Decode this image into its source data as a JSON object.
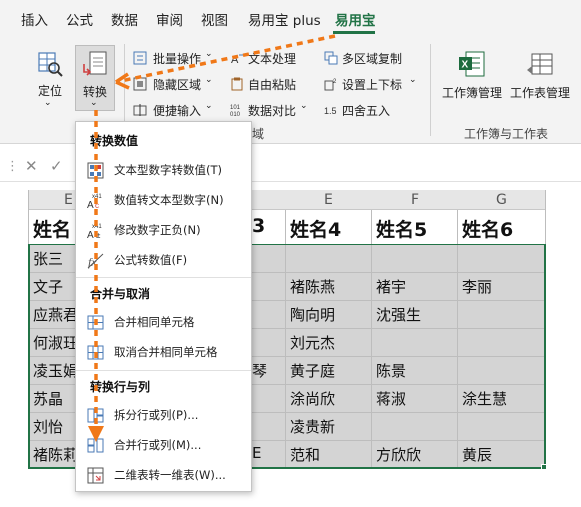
{
  "tabs": [
    {
      "label": "插入"
    },
    {
      "label": "公式"
    },
    {
      "label": "数据"
    },
    {
      "label": "审阅"
    },
    {
      "label": "视图"
    },
    {
      "label": "易用宝 plus"
    },
    {
      "label": "易用宝"
    }
  ],
  "ribbon": {
    "locate": "定位",
    "convert": "转换",
    "batch_ops": "批量操作",
    "text_process": "文本处理",
    "multi_copy": "多区域复制",
    "hide_area": "隐藏区域",
    "free_paste": "自由粘贴",
    "set_sub": "设置上下标",
    "quick_input": "便捷输入",
    "data_compare": "数据对比",
    "round": "四舍五入",
    "area_label": "域",
    "wb_manage": "工作簿管理",
    "ws_manage": "工作表管理",
    "group_label": "工作簿与工作表"
  },
  "menu": {
    "sec_convert": "转换数值",
    "sec_merge": "合并与取消",
    "sec_rowcol": "转换行与列",
    "items": [
      {
        "label": "文本型数字转数值(T)"
      },
      {
        "label": "数值转文本型数字(N)"
      },
      {
        "label": "修改数字正负(N)"
      },
      {
        "label": "公式转数值(F)"
      },
      {
        "label": "合并相同单元格"
      },
      {
        "label": "取消合并相同单元格"
      },
      {
        "label": "拆分行或列(P)..."
      },
      {
        "label": "合并行或列(M)..."
      },
      {
        "label": "二维表转一维表(W)..."
      }
    ]
  },
  "columns": [
    "E",
    "F",
    "G"
  ],
  "col_partial": "E",
  "headers": {
    "col_a": "姓名",
    "col_d": "3",
    "col_e": "姓名4",
    "col_f": "姓名5",
    "col_g": "姓名6"
  },
  "rows": [
    {
      "a": "张三",
      "e": "",
      "f": "",
      "g": ""
    },
    {
      "a": "文子",
      "e": "褚陈燕",
      "f": "褚宇",
      "g": "李丽"
    },
    {
      "a": "应燕君",
      "e": "陶向明",
      "f": "沈强生",
      "g": ""
    },
    {
      "a": "何淑珏",
      "e": "刘元杰",
      "f": "",
      "g": ""
    },
    {
      "a": "凌玉娟",
      "d": "琴",
      "e": "黄子庭",
      "f": "陈景",
      "g": ""
    },
    {
      "a": "苏晶",
      "e": "涂尚欣",
      "f": "蒋淑",
      "g": "涂生慧"
    },
    {
      "a": "刘怡",
      "e": "凌贵新",
      "f": "",
      "g": ""
    },
    {
      "a": "褚陈莉",
      "d": "E",
      "e": "范和",
      "f": "方欣欣",
      "g": "黄辰"
    }
  ],
  "colors": {
    "accent": "#217346",
    "arrow": "#f07818",
    "selection": "#d4d4d4"
  }
}
